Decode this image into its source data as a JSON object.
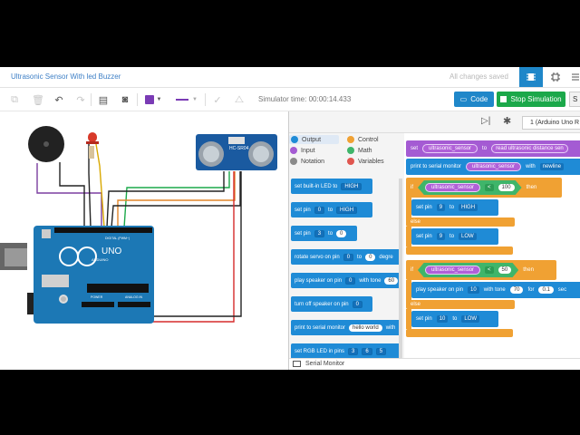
{
  "window": {
    "title": "Ultrasonic Sensor With led Buzzer",
    "save_status": "All changes saved"
  },
  "toolbar": {
    "sim_time": "Simulator time: 00:00:14.433",
    "code_label": "Code",
    "stop_label": "Stop Simulation",
    "share_label": "S"
  },
  "components": {
    "sensor_label": "HC-SR04",
    "board_brand": "UNO",
    "board_sub": "ARDUINO",
    "digital_label": "DIGITAL (PWM~)",
    "power_label": "POWER",
    "analog_label": "ANALOG IN"
  },
  "code": {
    "device": "1 (Arduino Uno R",
    "categories": [
      {
        "label": "Output",
        "color": "#1f8bd6"
      },
      {
        "label": "Control",
        "color": "#f0a133"
      },
      {
        "label": "Input",
        "color": "#a45bd3"
      },
      {
        "label": "Math",
        "color": "#3fb56a"
      },
      {
        "label": "Notation",
        "color": "#8a8a8a"
      },
      {
        "label": "Variables",
        "color": "#e0564f"
      }
    ],
    "palette": [
      {
        "text": "set built-in LED to",
        "d1": "HIGH"
      },
      {
        "text": "set pin",
        "d1": "0",
        "mid": "to",
        "d2": "HIGH"
      },
      {
        "text": "set pin",
        "d1": "3",
        "mid": "to",
        "f": "0"
      },
      {
        "text": "rotate servo on pin",
        "d1": "0",
        "mid": "to",
        "f": "0",
        "end": "degre"
      },
      {
        "text": "play speaker on pin",
        "d1": "0",
        "mid": "with tone",
        "f": "60"
      },
      {
        "text": "turn off speaker on pin",
        "d1": "0"
      },
      {
        "text": "print to serial monitor",
        "f": "hello world",
        "end": "with"
      },
      {
        "text": "set RGB LED in pins",
        "d1": "3",
        "d2": "6",
        "d3": "5"
      }
    ],
    "serial_monitor": "Serial Monitor",
    "script": {
      "set_kw": "set",
      "var": "ultrasonic_sensor",
      "to": "to",
      "read": "read ultrasonic distance sen",
      "print": "print to serial monitor",
      "with": "with",
      "newline": "newline",
      "if1_op": "<",
      "if1_val": "100",
      "then": "then",
      "else": "else",
      "setpin": "set pin",
      "pin9": "9",
      "high": "HIGH",
      "low": "LOW",
      "if2_val": "50",
      "play": "play speaker on pin",
      "pin10": "10",
      "withtone": "with tone",
      "tone": "70",
      "for": "for",
      "dur": "0.1",
      "sec": "sec"
    }
  }
}
